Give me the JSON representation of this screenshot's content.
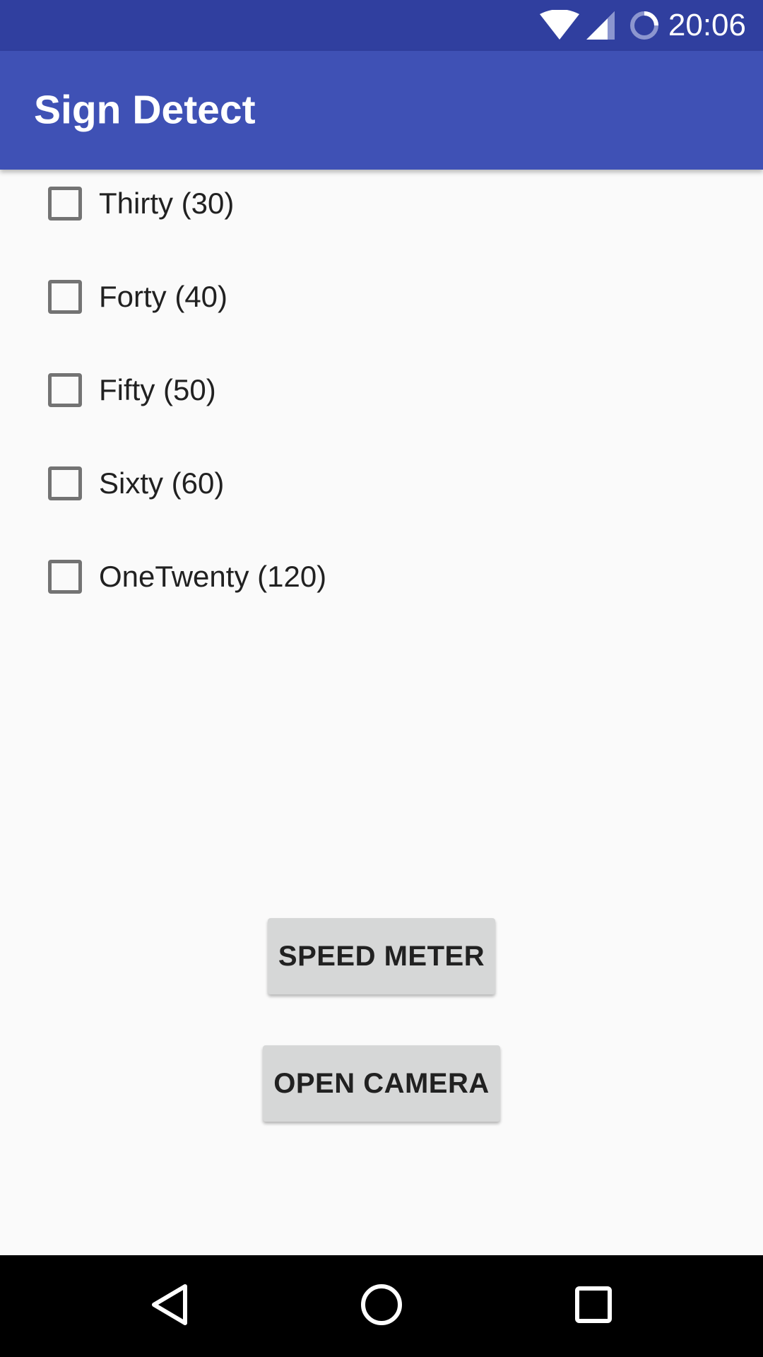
{
  "status_bar": {
    "time": "20:06",
    "icons": [
      "wifi-icon",
      "cell-signal-icon",
      "sync-icon"
    ]
  },
  "app_bar": {
    "title": "Sign Detect"
  },
  "checkboxes": [
    {
      "label": "Thirty (30)",
      "checked": false
    },
    {
      "label": "Forty (40)",
      "checked": false
    },
    {
      "label": "Fifty (50)",
      "checked": false
    },
    {
      "label": "Sixty (60)",
      "checked": false
    },
    {
      "label": "OneTwenty (120)",
      "checked": false
    }
  ],
  "buttons": {
    "speed_meter": "SPEED METER",
    "open_camera": "OPEN CAMERA"
  },
  "nav_bar": {
    "icons": [
      "back-icon",
      "home-icon",
      "recents-icon"
    ]
  },
  "colors": {
    "status_bar": "#303f9f",
    "app_bar": "#3f51b5",
    "background": "#fafafa",
    "button": "#d6d7d7"
  }
}
